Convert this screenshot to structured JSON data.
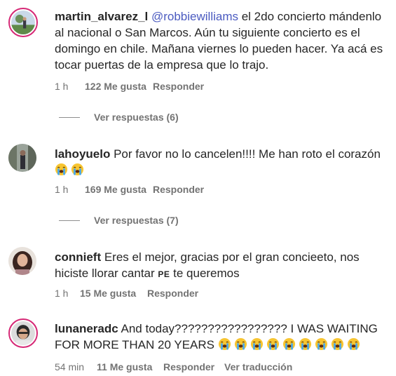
{
  "comments": [
    {
      "username": "martin_alvarez_l",
      "mention": "@robbiewilliams",
      "text": " el 2do concierto mándenlo al nacional o San Marcos. Aún tu siguiente concierto es el domingo en chile. Mañana viernes lo pueden hacer. Ya acá es tocar puertas de la empresa que lo trajo.",
      "time": "1 h",
      "likes": "122 Me gusta",
      "reply": "Responder",
      "view_replies": "Ver respuestas (6)"
    },
    {
      "username": "lahoyuelo",
      "text": "Por favor no lo cancelen!!!! Me han roto el corazón",
      "emoji_count": 2,
      "time": "1 h",
      "likes": "169 Me gusta",
      "reply": "Responder",
      "view_replies": "Ver respuestas (7)"
    },
    {
      "username": "connieft",
      "text_before": "Eres el mejor, gracias por el gran concieeto, nos hiciste llorar cantar ",
      "small_caps": "PE",
      "text_after": " te queremos",
      "time": "1 h",
      "likes": "15 Me gusta",
      "reply": "Responder"
    },
    {
      "username": "lunaneradc",
      "text": "And today????????????????? I WAS WAITING FOR MORE THAN 20 YEARS",
      "emoji_count": 9,
      "time": "54 min",
      "likes": "11 Me gusta",
      "reply": "Responder",
      "translate": "Ver traducción"
    }
  ],
  "icons": {
    "emoji": "loudly-crying-face"
  },
  "colors": {
    "mention": "#4a5ac0",
    "story_ring": "#d62976",
    "meta": "#737373"
  }
}
